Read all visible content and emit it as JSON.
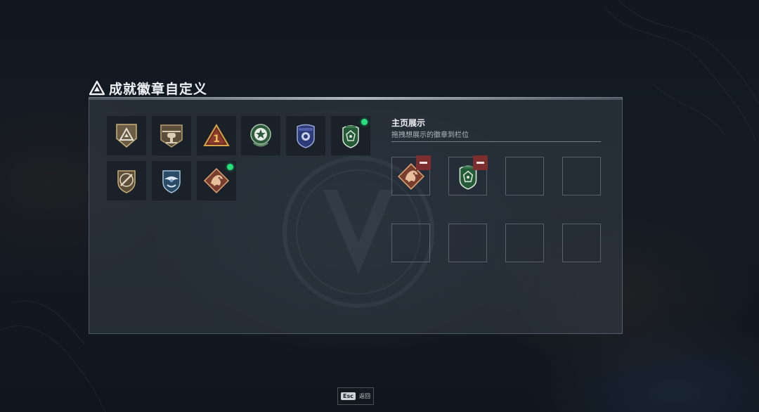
{
  "header": {
    "title": "成就徽章自定义"
  },
  "inventory": {
    "badges": [
      {
        "icon": "triangle-emblem-badge-icon",
        "new": false
      },
      {
        "icon": "helicopter-badge-icon",
        "new": false
      },
      {
        "icon": "number-one-triangle-badge-icon",
        "new": false
      },
      {
        "icon": "green-star-badge-icon",
        "new": false
      },
      {
        "icon": "blue-police-shield-badge-icon",
        "new": false
      },
      {
        "icon": "green-crest-shield-badge-icon",
        "new": true
      },
      {
        "icon": "rifle-shield-badge-icon",
        "new": false
      },
      {
        "icon": "blue-eagle-shield-badge-icon",
        "new": false
      },
      {
        "icon": "bronze-dragon-badge-icon",
        "new": true
      }
    ]
  },
  "showcase": {
    "title": "主页展示",
    "subtitle": "拖拽想展示的徽章到栏位",
    "slots": [
      {
        "icon": "bronze-dragon-badge-icon",
        "filled": true
      },
      {
        "icon": "green-crest-shield-badge-icon",
        "filled": true
      },
      {
        "filled": false
      },
      {
        "filled": false
      },
      {
        "filled": false
      },
      {
        "filled": false
      },
      {
        "filled": false
      },
      {
        "filled": false
      }
    ]
  },
  "footer": {
    "esc_key": "Esc",
    "back_label": "返回"
  },
  "colors": {
    "new_indicator": "#28e07a",
    "remove_button": "#7c2d2d",
    "panel_border": "#a0afbe"
  }
}
